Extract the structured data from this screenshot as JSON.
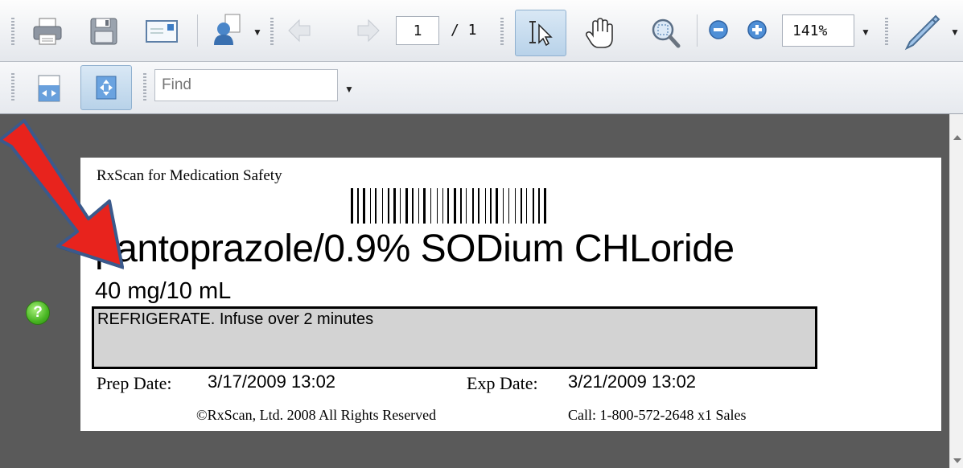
{
  "toolbar": {
    "page_current": "1",
    "page_total": "/ 1",
    "zoom": "141%"
  },
  "find": {
    "placeholder": "Find"
  },
  "label": {
    "header": "RxScan for Medication Safety",
    "drug_name": "pantoprazole/0.9% SODium CHLoride",
    "dose": "40 mg/10 mL",
    "instructions": "REFRIGERATE. Infuse over 2 minutes",
    "prep_label": "Prep Date:",
    "prep_value": "3/17/2009 13:02",
    "exp_label": "Exp Date:",
    "exp_value": "3/21/2009 13:02",
    "copyright": "©RxScan, Ltd. 2008 All Rights Reserved",
    "call": "Call: 1-800-572-2648 x1 Sales"
  },
  "help": {
    "symbol": "?"
  },
  "colors": {
    "arrow": "#e8231d",
    "arrow_outline": "#3b5a8c",
    "help_green": "#48b522",
    "accent": "#2d6ec7"
  }
}
